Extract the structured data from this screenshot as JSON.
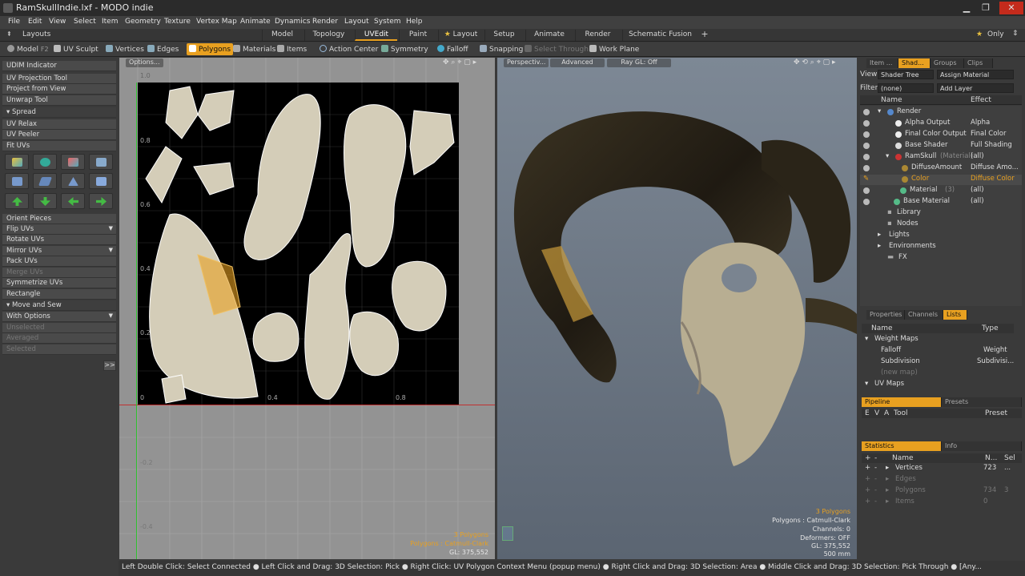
{
  "window": {
    "title": "RamSkullIndie.lxf - MODO indie",
    "minimize": "▁",
    "maximize": "❐",
    "close": "✕"
  },
  "menu": [
    "File",
    "Edit",
    "View",
    "Select",
    "Item",
    "Geometry",
    "Texture",
    "Vertex Map",
    "Animate",
    "Dynamics",
    "Render",
    "Layout",
    "System",
    "Help"
  ],
  "layoutbar": {
    "layouts": "Layouts",
    "tabs": [
      "Model",
      "Topology",
      "UVEdit",
      "Paint",
      "Layout",
      "Setup",
      "Animate",
      "Render",
      "Schematic Fusion"
    ],
    "active_tab": "UVEdit",
    "plus": "+",
    "only": "Only"
  },
  "toolbar": {
    "model": "Model",
    "model_key": "F2",
    "uv_sculpt": "UV Sculpt",
    "vertices": "Vertices",
    "edges": "Edges",
    "polygons": "Polygons",
    "materials": "Materials",
    "items": "Items",
    "action_center": "Action Center",
    "symmetry": "Symmetry",
    "falloff": "Falloff",
    "snapping": "Snapping",
    "select_through": "Select Through",
    "work_plane": "Work Plane"
  },
  "left_panel": {
    "udim": "UDIM Indicator",
    "uv_projection": "UV Projection Tool",
    "project_from_view": "Project from View",
    "unwrap": "Unwrap Tool",
    "spread": "Spread",
    "uv_relax": "UV Relax",
    "uv_peeler": "UV Peeler",
    "fit_uvs": "Fit UVs",
    "orient_pieces": "Orient Pieces",
    "flip_uvs": "Flip UVs",
    "rotate_uvs": "Rotate UVs",
    "mirror_uvs": "Mirror UVs",
    "pack_uvs": "Pack UVs",
    "merge_uvs": "Merge UVs",
    "symmetrize_uvs": "Symmetrize UVs",
    "rectangle": "Rectangle",
    "move_and_sew": "Move and Sew",
    "with_options": "With Options",
    "unselected": "Unselected",
    "averaged": "Averaged",
    "selected": "Selected",
    "expand": ">>"
  },
  "uv_view": {
    "options": "Options...",
    "ticks_v": [
      "1.0",
      "0.8",
      "0.6",
      "0.4",
      "0.2",
      "0",
      "-0.2",
      "-0.4"
    ],
    "ticks_u": [
      "0.4",
      "0.8"
    ],
    "overlay": {
      "polys": "3 Polygons",
      "type": "Polygons : Catmull-Clark",
      "gl": "GL: 375,552"
    }
  },
  "persp_view": {
    "perspective": "Perspectiv...",
    "advanced": "Advanced",
    "raygl": "Ray GL: Off",
    "overlay": {
      "polys": "3 Polygons",
      "type": "Polygons : Catmull-Clark",
      "channels": "Channels: 0",
      "deformers": "Deformers: OFF",
      "gl": "GL: 375,552",
      "size": "500 mm"
    }
  },
  "shader_panel": {
    "tabs": [
      "Item ...",
      "Shad...",
      "Groups",
      "Clips"
    ],
    "active_tab": "Shad...",
    "view_label": "View",
    "view_value": "Shader Tree",
    "assign_material": "Assign Material",
    "filter_label": "Filter",
    "filter_value": "(none)",
    "add_layer": "Add Layer",
    "col_name": "Name",
    "col_effect": "Effect",
    "rows": [
      {
        "name": "Render",
        "effect": "",
        "indent": 0
      },
      {
        "name": "Alpha Output",
        "effect": "Alpha",
        "indent": 1
      },
      {
        "name": "Final Color Output",
        "effect": "Final Color",
        "indent": 1
      },
      {
        "name": "Base Shader",
        "effect": "Full Shading",
        "indent": 1
      },
      {
        "name": "RamSkull",
        "tag": "(Material)",
        "effect": "(all)",
        "indent": 1
      },
      {
        "name": "DiffuseAmount",
        "effect": "Diffuse Amo...",
        "indent": 2
      },
      {
        "name": "Color",
        "effect": "Diffuse Color",
        "indent": 2,
        "selected": true
      },
      {
        "name": "Material",
        "tag": "(3)",
        "effect": "(all)",
        "indent": 2
      },
      {
        "name": "Base Material",
        "effect": "(all)",
        "indent": 1
      },
      {
        "name": "Library",
        "effect": "",
        "indent": 0
      },
      {
        "name": "Nodes",
        "effect": "",
        "indent": 0
      },
      {
        "name": "Lights",
        "effect": "",
        "indent": 0
      },
      {
        "name": "Environments",
        "effect": "",
        "indent": 0
      },
      {
        "name": "FX",
        "effect": "",
        "indent": 0
      }
    ]
  },
  "lists_panel": {
    "tabs": [
      "Properties",
      "Channels",
      "Lists"
    ],
    "active_tab": "Lists",
    "col_name": "Name",
    "col_type": "Type",
    "rows": [
      {
        "name": "Weight Maps",
        "type": ""
      },
      {
        "name": "Falloff",
        "type": "Weight"
      },
      {
        "name": "Subdivision",
        "type": "Subdivisi..."
      },
      {
        "name": "(new map)",
        "type": ""
      },
      {
        "name": "UV Maps",
        "type": ""
      }
    ]
  },
  "pipeline_panel": {
    "tabs": [
      "Pipeline",
      "Presets"
    ],
    "cols": [
      "E",
      "V",
      "A",
      "Tool",
      "Preset"
    ]
  },
  "stats_panel": {
    "tabs": [
      "Statistics",
      "Info"
    ],
    "col_name": "Name",
    "col_n": "N...",
    "col_sel": "Sel",
    "rows": [
      {
        "name": "Vertices",
        "n": "723",
        "sel": "...",
        "dim": false
      },
      {
        "name": "Edges",
        "n": "",
        "sel": "",
        "dim": true
      },
      {
        "name": "Polygons",
        "n": "734",
        "sel": "3",
        "dim": true
      },
      {
        "name": "Items",
        "n": "0",
        "sel": "",
        "dim": true
      }
    ]
  },
  "status": "Left Double Click: Select Connected ● Left Click and Drag: 3D Selection: Pick ● Right Click: UV Polygon Context Menu (popup menu) ● Right Click and Drag: 3D Selection: Area ● Middle Click and Drag: 3D Selection: Pick Through ● [Any...",
  "colors": {
    "accent": "#e8a020",
    "panel": "#3a3a3a",
    "uv_bg": "#000000",
    "viewport": "#7d8895"
  }
}
